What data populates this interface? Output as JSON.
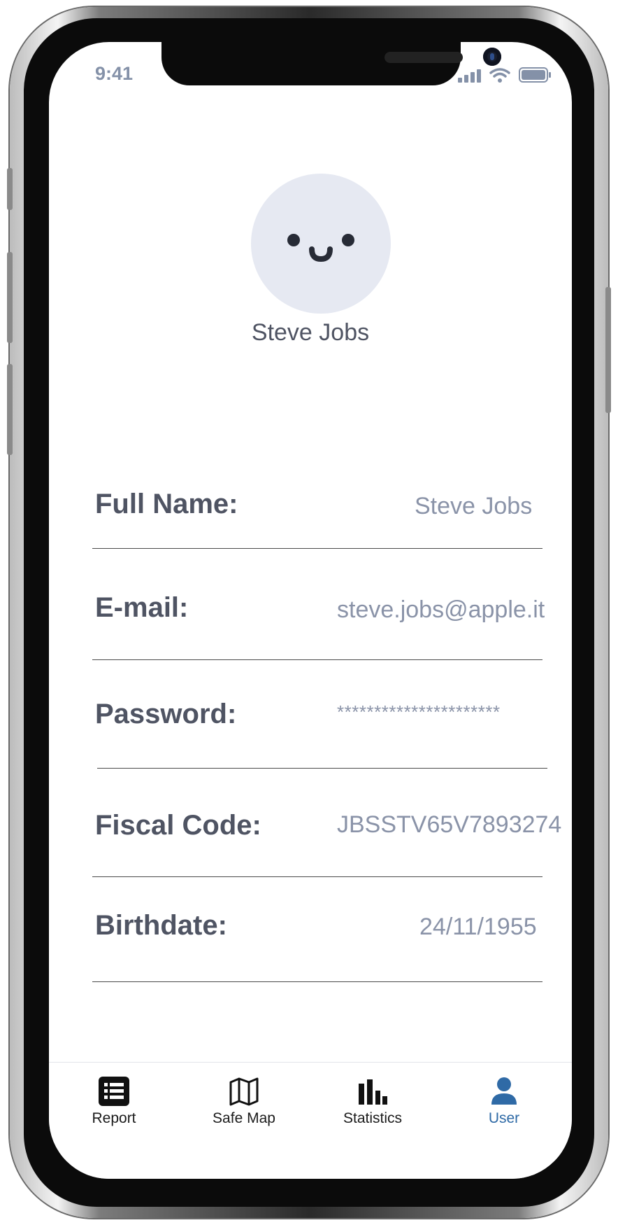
{
  "status_bar": {
    "time": "9:41"
  },
  "profile": {
    "name": "Steve Jobs"
  },
  "fields": [
    {
      "label": "Full Name:",
      "value": "Steve Jobs"
    },
    {
      "label": "E-mail:",
      "value": "steve.jobs@apple.it"
    },
    {
      "label": "Password:",
      "value": "**********************"
    },
    {
      "label": "Fiscal Code:",
      "value": "JBSSTV65V7893274"
    },
    {
      "label": "Birthdate:",
      "value": "24/11/1955"
    }
  ],
  "tabs": [
    {
      "label": "Report",
      "icon": "list-icon"
    },
    {
      "label": "Safe Map",
      "icon": "map-icon"
    },
    {
      "label": "Statistics",
      "icon": "bar-chart-icon"
    },
    {
      "label": "User",
      "icon": "user-icon",
      "active": true
    }
  ],
  "colors": {
    "accent": "#2f6aa6",
    "label_text": "#4f5463",
    "value_text": "#8a93a8",
    "avatar_bg": "#e6e9f2"
  }
}
